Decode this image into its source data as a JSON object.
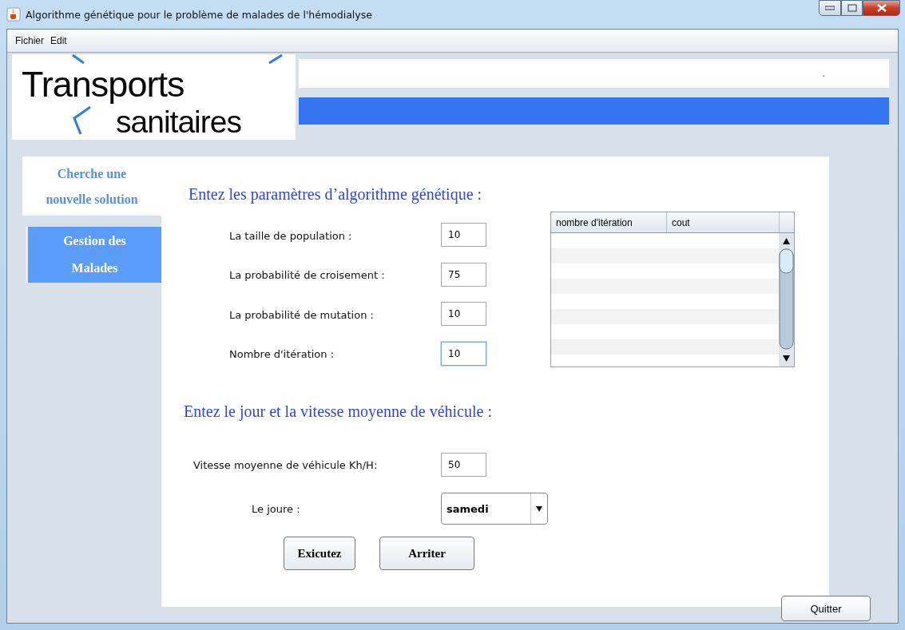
{
  "window": {
    "title": "Algorithme génétique pour le problème de malades de l'hémodialyse"
  },
  "menu": [
    {
      "label": "Fichier"
    },
    {
      "label": "Edit"
    }
  ],
  "logo": {
    "line1": "Transports",
    "line2": "sanitaires"
  },
  "header": {
    "field_value": ".",
    "progress": {
      "level": 1
    }
  },
  "sidebar": [
    {
      "label": "Cherche une nouvelle solution",
      "selected": true
    },
    {
      "label": "Gestion des Malades",
      "selected": false
    }
  ],
  "parameters": {
    "heading": "Entez les paramètres d’algorithme génétique :",
    "fields": [
      {
        "label": "La taille de population :",
        "value": "10",
        "focused": false
      },
      {
        "label": "La probabilité de croisement :",
        "value": "75",
        "focused": false
      },
      {
        "label": "La probabilité de mutation :",
        "value": "10",
        "focused": false
      },
      {
        "label": "Nombre d'itération :",
        "value": "10",
        "focused": true
      }
    ]
  },
  "table": {
    "columns": [
      "nombre d'itération",
      "cout"
    ]
  },
  "trip": {
    "heading": "Entez le jour et la vitesse moyenne de véhicule :",
    "speed": {
      "label": "Vitesse moyenne de véhicule Kh/H:",
      "value": "50"
    },
    "day": {
      "label": "Le joure :",
      "value": "samedi"
    }
  },
  "actions": [
    "Exicutez",
    "Arriter"
  ],
  "quit": "Quitter"
}
